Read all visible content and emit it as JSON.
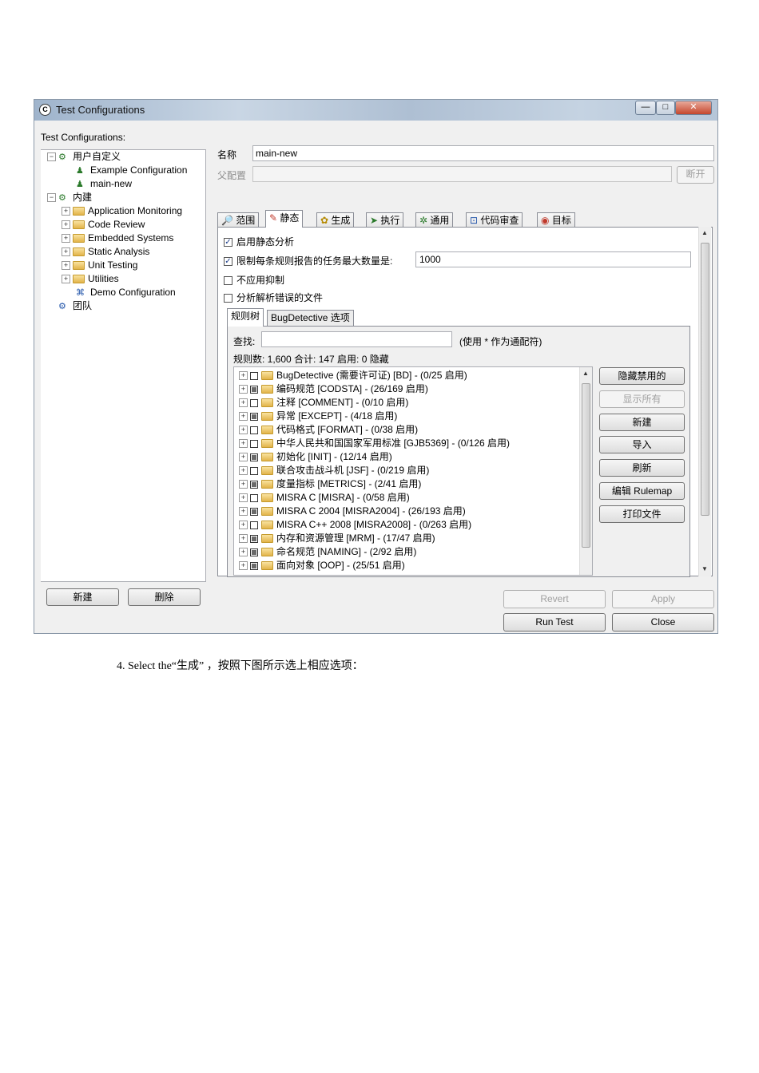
{
  "window": {
    "title": "Test Configurations",
    "controls": {
      "minimize": "—",
      "maximize": "□",
      "close": "✕"
    }
  },
  "tree": {
    "label": "Test Configurations:",
    "user_defined": {
      "label": "用户自定义",
      "children": [
        "Example Configuration",
        "main-new"
      ]
    },
    "builtin": {
      "label": "内建",
      "children": [
        "Application Monitoring",
        "Code Review",
        "Embedded Systems",
        "Static Analysis",
        "Unit Testing",
        "Utilities",
        "Demo Configuration"
      ]
    },
    "team": {
      "label": "团队"
    }
  },
  "left_buttons": {
    "new": "新建",
    "delete": "删除"
  },
  "form": {
    "name_label": "名称",
    "name_value": "main-new",
    "parent_label": "父配置",
    "parent_value": "",
    "disconnect": "断开"
  },
  "tabs": [
    "范围",
    "静态",
    "生成",
    "执行",
    "通用",
    "代码审查",
    "目标"
  ],
  "active_tab": "静态",
  "static": {
    "enable": "启用静态分析",
    "enable_checked": true,
    "limit": "限制每条规则报告的任务最大数量是:",
    "limit_checked": true,
    "limit_value": "1000",
    "no_suppress": "不应用抑制",
    "no_suppress_checked": false,
    "parse_errors": "分析解析错误的文件",
    "parse_errors_checked": false
  },
  "subtabs": [
    "规则树",
    "BugDetective 选项"
  ],
  "rules_panel": {
    "find_label": "查找:",
    "find_value": "",
    "wildcard_hint": "(使用 * 作为通配符)",
    "summary": "规则数: 1,600 合计: 147 启用: 0 隐藏",
    "rules": [
      {
        "text": "BugDetective (需要许可证) [BD] - (0/25 启用)",
        "state": "unchecked"
      },
      {
        "text": "编码规范 [CODSTA] - (26/169 启用)",
        "state": "partial"
      },
      {
        "text": "注释 [COMMENT] - (0/10 启用)",
        "state": "unchecked"
      },
      {
        "text": "异常 [EXCEPT] - (4/18 启用)",
        "state": "partial"
      },
      {
        "text": "代码格式 [FORMAT] - (0/38 启用)",
        "state": "unchecked"
      },
      {
        "text": "中华人民共和国国家军用标准 [GJB5369] - (0/126 启用)",
        "state": "unchecked"
      },
      {
        "text": "初始化 [INIT] - (12/14 启用)",
        "state": "partial"
      },
      {
        "text": "联合攻击战斗机 [JSF] - (0/219 启用)",
        "state": "unchecked"
      },
      {
        "text": "度量指标 [METRICS] - (2/41 启用)",
        "state": "partial"
      },
      {
        "text": "MISRA C [MISRA] - (0/58 启用)",
        "state": "unchecked"
      },
      {
        "text": "MISRA C 2004 [MISRA2004] - (26/193 启用)",
        "state": "partial"
      },
      {
        "text": "MISRA C++ 2008 [MISRA2008] - (0/263 启用)",
        "state": "unchecked"
      },
      {
        "text": "内存和资源管理 [MRM] - (17/47 启用)",
        "state": "partial"
      },
      {
        "text": "命名规范 [NAMING] - (2/92 启用)",
        "state": "partial"
      },
      {
        "text": "面向对象 [OOP] - (25/51 启用)",
        "state": "partial"
      }
    ],
    "side_buttons": {
      "hide_disabled": "隐藏禁用的",
      "show_all": "显示所有",
      "new": "新建",
      "import": "导入",
      "refresh": "刷新",
      "edit_rulemap": "编辑 Rulemap",
      "print": "打印文件"
    }
  },
  "bottom_buttons": {
    "revert": "Revert",
    "apply": "Apply",
    "run_test": "Run Test",
    "close": "Close"
  },
  "caption": "4. Select the“生成” ，按照下图所示选上相应选项："
}
